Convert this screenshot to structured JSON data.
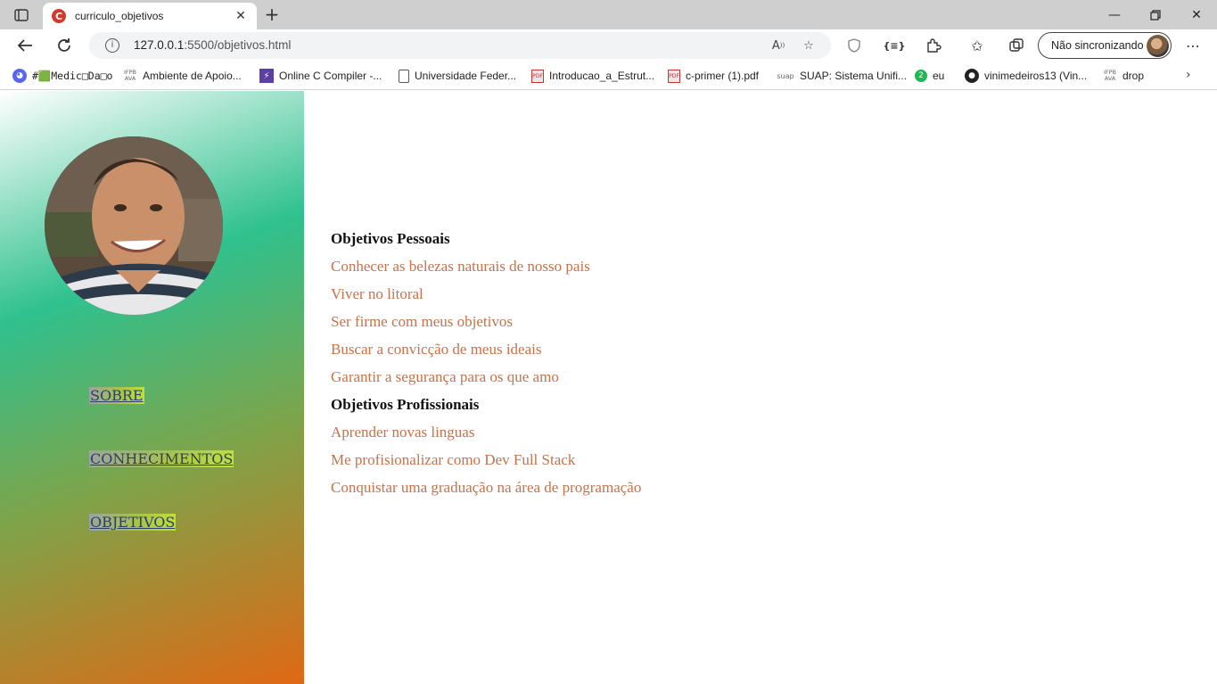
{
  "browser": {
    "tab_title": "curriculo_objetivos",
    "tab_favicon_letter": "C",
    "url_host": "127.0.0.1",
    "url_rest": ":5500/objetivos.html",
    "sync_label": "Não sincronizando",
    "bookmarks": [
      {
        "icon": "discord-icon",
        "label": "#🟩Medic□Da□o"
      },
      {
        "icon": "ifpb-ava-icon",
        "label": "Ambiente de Apoio..."
      },
      {
        "icon": "bolt-icon",
        "label": "Online C Compiler -..."
      },
      {
        "icon": "document-icon",
        "label": "Universidade Feder..."
      },
      {
        "icon": "pdf-icon",
        "label": "Introducao_a_Estrut..."
      },
      {
        "icon": "pdf-icon",
        "label": "c-primer (1).pdf"
      },
      {
        "icon": "suap-icon",
        "label": "SUAP: Sistema Unifi..."
      },
      {
        "icon": "badge-icon",
        "label": "eu"
      },
      {
        "icon": "github-icon",
        "label": "vinimedeiros13 (Vin..."
      },
      {
        "icon": "ifpb-ava-icon",
        "label": "drop"
      }
    ]
  },
  "sidebar": {
    "nav": [
      {
        "label": "SOBRE"
      },
      {
        "label": "CONHECIMENTOS"
      },
      {
        "label": "OBJETIVOS"
      }
    ]
  },
  "main": {
    "personal_heading": "Objetivos Pessoais",
    "personal_items": [
      "Conhecer as belezas naturais de nosso pais",
      "Viver no litoral",
      "Ser firme com meus objetivos",
      "Buscar a convicção de meus ideais",
      "Garantir a segurança para os que amo"
    ],
    "professional_heading": "Objetivos Profissionais",
    "professional_items": [
      "Aprender novas linguas",
      "Me profisionalizar como Dev Full Stack",
      "Conquistar uma graduação na área de programação"
    ]
  },
  "colors": {
    "item_text": "#c8714a",
    "heading_text": "#111111",
    "nav_text": "#2c3e66",
    "sidebar_gradient": [
      "#ffffff",
      "#2fc18e",
      "#7ea44a",
      "#e06814"
    ]
  }
}
